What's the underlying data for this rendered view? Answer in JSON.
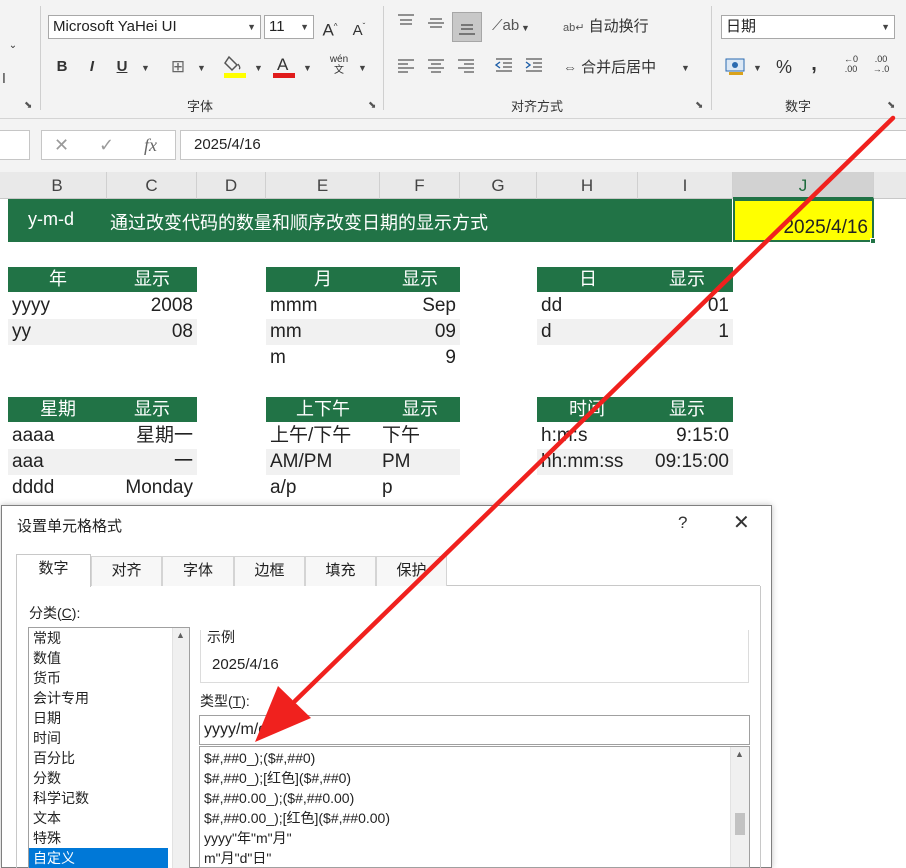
{
  "ribbon": {
    "font_group": {
      "font_name": "Microsoft YaHei UI",
      "font_size": "11",
      "grow_font": "A",
      "shrink_font": "A",
      "bold": "B",
      "italic": "I",
      "underline": "U",
      "phonetic": "wén\n文",
      "label": "字体"
    },
    "align_group": {
      "wrap_text": "自动换行",
      "merge_center": "合并后居中",
      "label": "对齐方式"
    },
    "number_group": {
      "format": "日期",
      "percent": "%",
      "comma": ",",
      "label": "数字"
    }
  },
  "formula_bar": {
    "fx": "fx",
    "value": "2025/4/16"
  },
  "columns": [
    "B",
    "C",
    "D",
    "E",
    "F",
    "G",
    "H",
    "I",
    "J"
  ],
  "sheet": {
    "banner_code": "y-m-d",
    "banner_desc": "通过改变代码的数量和顺序改变日期的显示方式",
    "j_value": "2025/4/16",
    "year_table": {
      "headers": [
        "年",
        "显示"
      ],
      "rows": [
        [
          "yyyy",
          "2008"
        ],
        [
          "yy",
          "08"
        ]
      ]
    },
    "month_table": {
      "headers": [
        "月",
        "显示"
      ],
      "rows": [
        [
          "mmm",
          "Sep"
        ],
        [
          "mm",
          "09"
        ],
        [
          "m",
          "9"
        ]
      ]
    },
    "day_table": {
      "headers": [
        "日",
        "显示"
      ],
      "rows": [
        [
          "dd",
          "01"
        ],
        [
          "d",
          "1"
        ]
      ]
    },
    "week_table": {
      "headers": [
        "星期",
        "显示"
      ],
      "rows": [
        [
          "aaaa",
          "星期一"
        ],
        [
          "aaa",
          "一"
        ],
        [
          "dddd",
          "Monday"
        ]
      ]
    },
    "ampm_table": {
      "headers": [
        "上下午",
        "显示"
      ],
      "rows": [
        [
          "上午/下午",
          "下午"
        ],
        [
          "AM/PM",
          "PM"
        ],
        [
          "a/p",
          "p"
        ]
      ]
    },
    "time_table": {
      "headers": [
        "时间",
        "显示"
      ],
      "rows": [
        [
          "h:m:s",
          "9:15:0"
        ],
        [
          "hh:mm:ss",
          "09:15:00"
        ]
      ]
    }
  },
  "dialog": {
    "title": "设置单元格格式",
    "help": "?",
    "close": "✕",
    "tabs": [
      "数字",
      "对齐",
      "字体",
      "边框",
      "填充",
      "保护"
    ],
    "category_label": "分类(",
    "category_key": "C",
    "category_label_end": "):",
    "categories": [
      "常规",
      "数值",
      "货币",
      "会计专用",
      "日期",
      "时间",
      "百分比",
      "分数",
      "科学记数",
      "文本",
      "特殊",
      "自定义"
    ],
    "selected_category": "自定义",
    "sample_label": "示例",
    "sample_value": "2025/4/16",
    "type_label": "类型(",
    "type_key": "T",
    "type_label_end": "):",
    "type_value": "yyyy/m/d",
    "formats": [
      "$#,##0_);($#,##0)",
      "$#,##0_);[红色]($#,##0)",
      "$#,##0.00_);($#,##0.00)",
      "$#,##0.00_);[红色]($#,##0.00)",
      "yyyy\"年\"m\"月\"",
      "m\"月\"d\"日\""
    ]
  },
  "colors": {
    "excel_green": "#217346",
    "highlight_yellow": "#ffff00",
    "selection_blue": "#0078d7",
    "annotation_red": "#f0211e"
  }
}
